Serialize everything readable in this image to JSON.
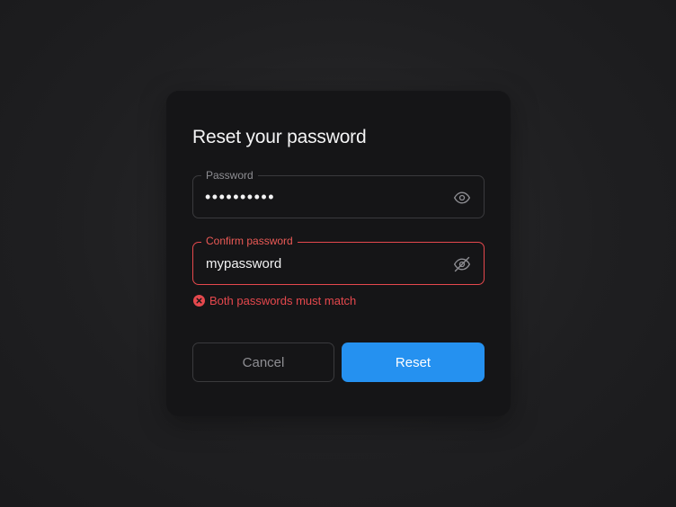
{
  "dialog": {
    "title": "Reset your password",
    "password": {
      "label": "Password",
      "value": "••••••••••",
      "visibility_icon": "eye-icon"
    },
    "confirm": {
      "label": "Confirm password",
      "value": "mypassword",
      "visibility_icon": "eye-off-icon"
    },
    "error": {
      "icon": "error-circle-icon",
      "message": "Both passwords must match"
    },
    "buttons": {
      "cancel_label": "Cancel",
      "reset_label": "Reset"
    }
  },
  "colors": {
    "background": "#1f1f21",
    "card": "#151517",
    "accent": "#2591f0",
    "error": "#e5484d",
    "border": "#3a3a3d"
  }
}
